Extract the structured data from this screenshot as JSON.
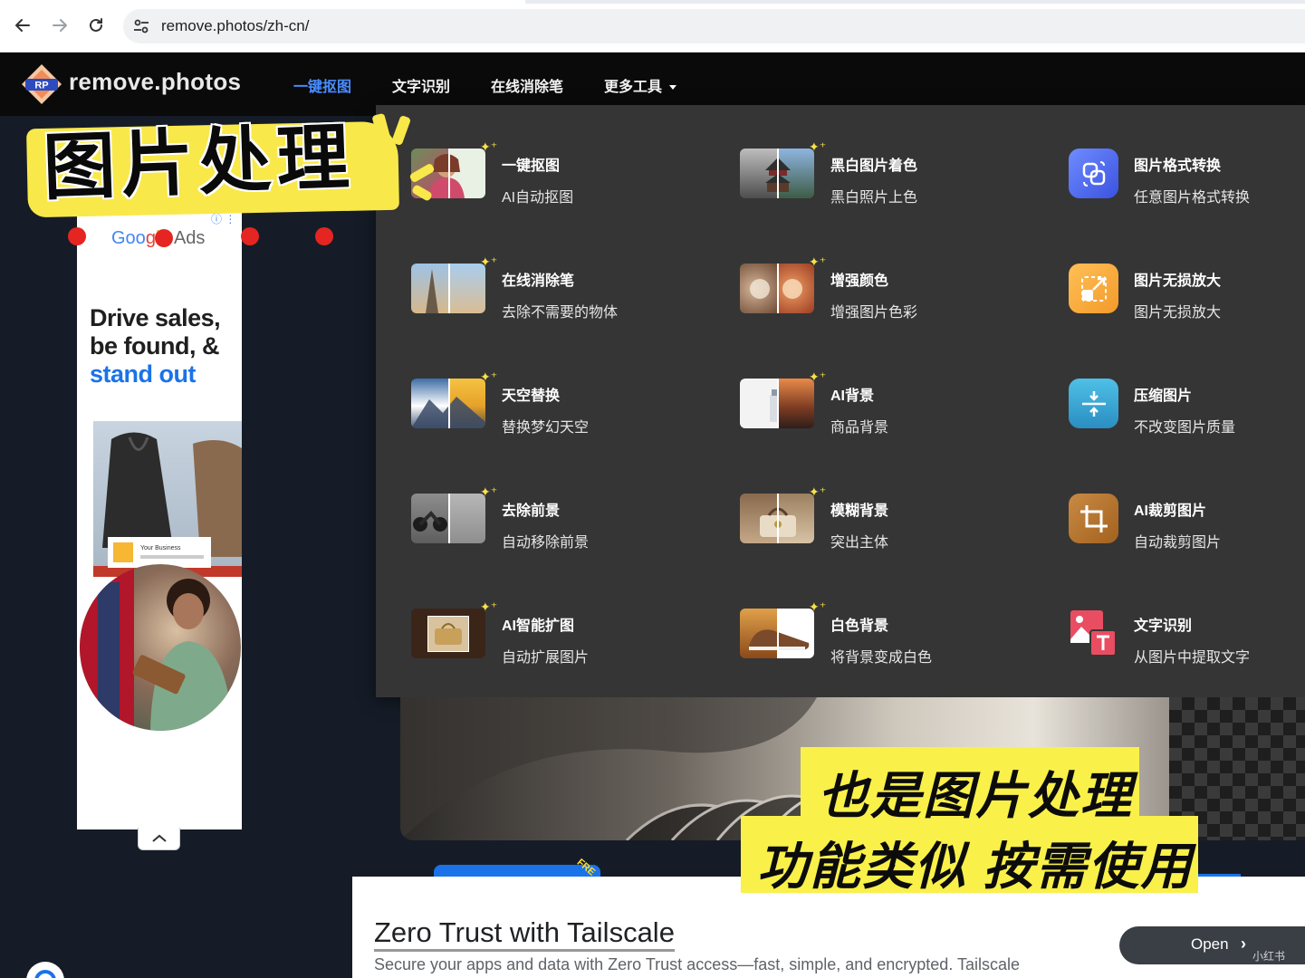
{
  "browser": {
    "url": "remove.photos/zh-cn/"
  },
  "header": {
    "logo_mark": "RP",
    "logo_text": "remove.photos",
    "menu": [
      {
        "label": "一键抠图",
        "active": true
      },
      {
        "label": "文字识别",
        "active": false
      },
      {
        "label": "在线消除笔",
        "active": false
      },
      {
        "label": "更多工具",
        "active": false,
        "has_dropdown": true
      }
    ]
  },
  "dropdown": {
    "columns": [
      [
        {
          "name": "一键抠图",
          "desc": "AI自动抠图"
        },
        {
          "name": "在线消除笔",
          "desc": "去除不需要的物体"
        },
        {
          "name": "天空替换",
          "desc": "替换梦幻天空"
        },
        {
          "name": "去除前景",
          "desc": "自动移除前景"
        },
        {
          "name": "AI智能扩图",
          "desc": "自动扩展图片"
        }
      ],
      [
        {
          "name": "黑白图片着色",
          "desc": "黑白照片上色"
        },
        {
          "name": "增强颜色",
          "desc": "增强图片色彩"
        },
        {
          "name": "AI背景",
          "desc": "商品背景"
        },
        {
          "name": "模糊背景",
          "desc": "突出主体"
        },
        {
          "name": "白色背景",
          "desc": "将背景变成白色"
        }
      ],
      [
        {
          "name": "图片格式转换",
          "desc": "任意图片格式转换",
          "icon": "convert-icon",
          "color": "#4f6df5"
        },
        {
          "name": "图片无损放大",
          "desc": "图片无损放大",
          "icon": "enlarge-icon",
          "color": "#f7a23b"
        },
        {
          "name": "压缩图片",
          "desc": "不改变图片质量",
          "icon": "compress-icon",
          "color": "#3fa6d6"
        },
        {
          "name": "AI裁剪图片",
          "desc": "自动裁剪图片",
          "icon": "crop-icon",
          "color": "#b8742e"
        },
        {
          "name": "文字识别",
          "desc": "从图片中提取文字",
          "icon": "ocr-icon",
          "color": "#e74c5e"
        }
      ]
    ]
  },
  "side_ad": {
    "brand_letters": [
      "Goo",
      "g",
      "l",
      "e"
    ],
    "brand_suffix": "Ads",
    "headline_dark": "Drive sales, be found, &",
    "headline_blue": "stand out",
    "card_label": "Your Business"
  },
  "hero": {
    "free_tag": "FRE"
  },
  "bottom_ad": {
    "title": "Zero Trust with Tailscale",
    "desc": "Secure your apps and data with Zero Trust access—fast, simple, and encrypted. Tailscale",
    "button": "Open"
  },
  "overlay": {
    "sticker_title": "图片处理",
    "caption_line1": "也是图片处理",
    "caption_line2": "功能类似 按需使用",
    "watermark": "小红书"
  },
  "colors": {
    "accent": "#4a8dff",
    "sticker_yellow": "#f9e84a",
    "panel_bg": "#353535",
    "header_bg": "#0a0a0b",
    "page_bg": "#151c27"
  }
}
